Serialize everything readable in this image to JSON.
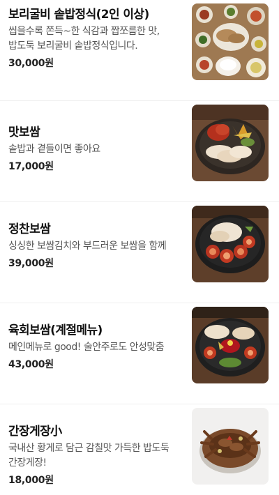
{
  "menu": {
    "items": [
      {
        "name": "보리굴비 솥밥정식(2인 이상)",
        "description": "씹을수록 쫀득~한 식감과 짭쪼름한 맛, 밥도둑 보리굴비 솥밥정식입니다.",
        "price": "30,000원",
        "image_icon": "table-setting-photo"
      },
      {
        "name": "맛보쌈",
        "description": "솥밥과 곁들이면 좋아요",
        "price": "17,000원",
        "image_icon": "bossam-platter-photo"
      },
      {
        "name": "정찬보쌈",
        "description": "싱싱한 보쌈김치와 부드러운 보쌈을 함께",
        "price": "39,000원",
        "image_icon": "bossam-kimchi-photo"
      },
      {
        "name": "육회보쌈(계절메뉴)",
        "description": "메인메뉴로 good! 술안주로도 안성맞춤",
        "price": "43,000원",
        "image_icon": "yukhoe-bossam-photo"
      },
      {
        "name": "간장게장小",
        "description": "국내산 황게로 담근 감칠맛 가득한 밥도둑 간장게장!",
        "price": "18,000원",
        "image_icon": "soy-crab-photo"
      }
    ]
  }
}
